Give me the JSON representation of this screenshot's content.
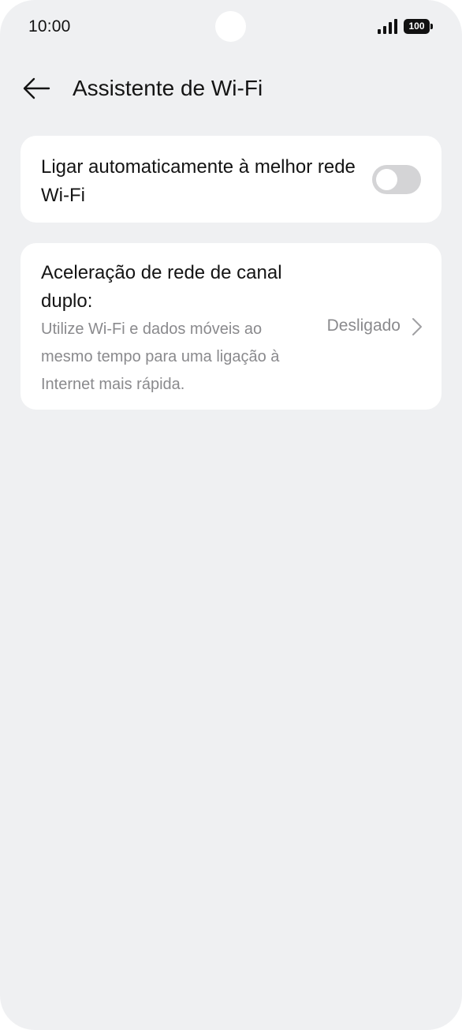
{
  "status_bar": {
    "time": "10:00",
    "battery": "100",
    "icons": [
      "signal-icon",
      "battery-icon"
    ]
  },
  "header": {
    "title": "Assistente de Wi-Fi",
    "back_icon": "back-arrow-icon"
  },
  "auto_connect": {
    "title": "Ligar automaticamente à melhor rede Wi-Fi",
    "enabled": false
  },
  "dual_channel": {
    "title": "Aceleração de rede de canal duplo:",
    "description": "Utilize Wi-Fi e dados móveis ao mesmo tempo para uma ligação à Internet mais rápida.",
    "value": "Desligado",
    "chevron_icon": "chevron-right-icon"
  },
  "colors": {
    "background": "#eff0f2",
    "card": "#ffffff",
    "primary_text": "#141414",
    "secondary_text": "#8a8a8d",
    "toggle_off": "#d4d4d6"
  }
}
